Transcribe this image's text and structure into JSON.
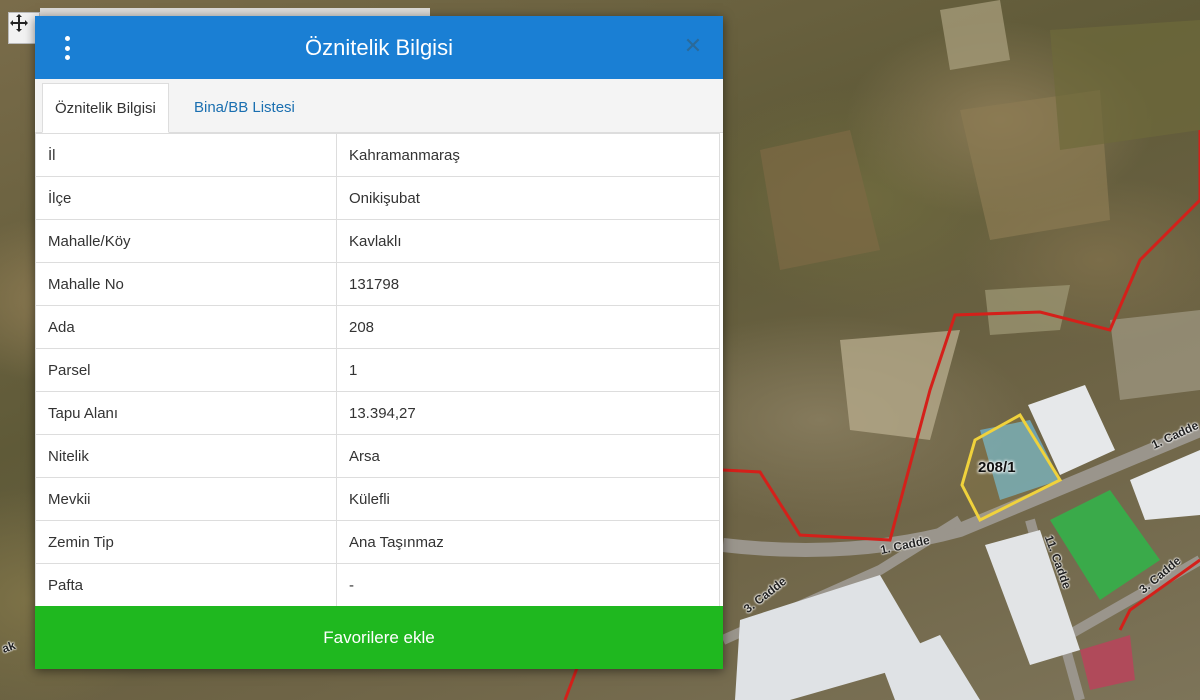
{
  "dialog": {
    "title": "Öznitelik Bilgisi",
    "tabs": [
      {
        "label": "Öznitelik Bilgisi",
        "active": true
      },
      {
        "label": "Bina/BB Listesi",
        "active": false
      }
    ],
    "rows": [
      {
        "key": "İl",
        "value": "Kahramanmaraş"
      },
      {
        "key": "İlçe",
        "value": "Onikişubat"
      },
      {
        "key": "Mahalle/Köy",
        "value": "Kavlaklı"
      },
      {
        "key": "Mahalle No",
        "value": "131798"
      },
      {
        "key": "Ada",
        "value": "208"
      },
      {
        "key": "Parsel",
        "value": "1"
      },
      {
        "key": "Tapu Alanı",
        "value": "13.394,27"
      },
      {
        "key": "Nitelik",
        "value": "Arsa"
      },
      {
        "key": "Mevkii",
        "value": "Külefli"
      },
      {
        "key": "Zemin Tip",
        "value": "Ana Taşınmaz"
      },
      {
        "key": "Pafta",
        "value": "-"
      }
    ],
    "favorite_button": "Favorilere ekle"
  },
  "map": {
    "parcel_label": "208/1",
    "road_labels": [
      "1. Cadde",
      "1. Cadde",
      "11. Cadde",
      "3. Cadde",
      "3. Cadde",
      "ak"
    ],
    "colors": {
      "boundary": "#d4201a",
      "parcel": "#f0d23c",
      "green_roof": "#3aaa4a"
    }
  },
  "icons": {
    "pan_tool": "move-icon",
    "menu": "kebab-menu-icon",
    "close": "close-icon"
  }
}
